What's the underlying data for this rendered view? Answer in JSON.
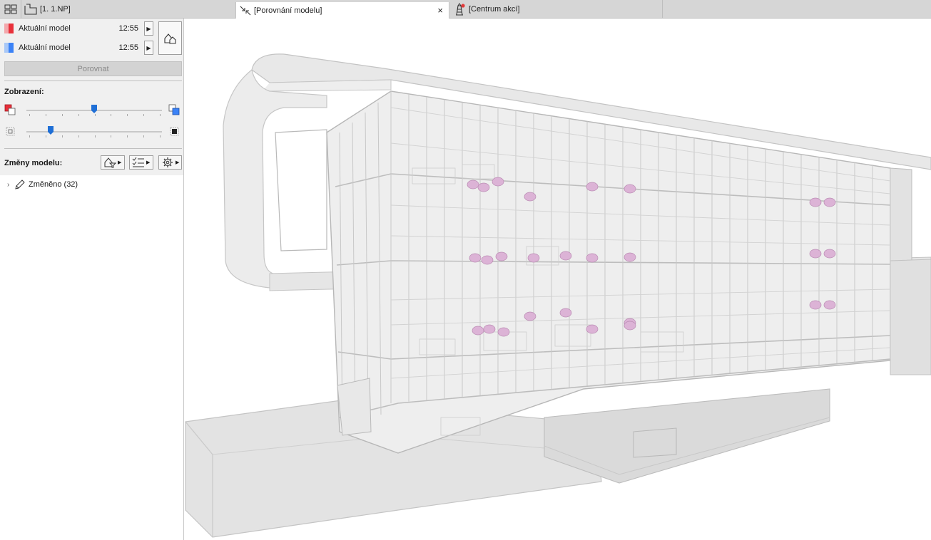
{
  "tabs": {
    "floor_label": "[1. 1.NP]",
    "compare_label": "[Porovnání modelu]",
    "action_label": "[Centrum akcí]",
    "close_glyph": "×"
  },
  "panel": {
    "models": [
      {
        "name": "Aktuální model",
        "time": "12:55",
        "color": "#e8303a"
      },
      {
        "name": "Aktuální model",
        "time": "12:55",
        "color": "#3b82f6"
      }
    ],
    "compare_button": "Porovnat",
    "display_label": "Zobrazení:",
    "sliders": [
      {
        "name": "model-color-mix",
        "value": 0.5
      },
      {
        "name": "transparency",
        "value": 0.18
      }
    ],
    "changes_label": "Změny modelu:",
    "tree": [
      {
        "label": "Změněno (32)",
        "expanded": false
      }
    ]
  },
  "colors": {
    "accent": "#1f6fd6",
    "old_model": "#e8303a",
    "new_model": "#3b82f6",
    "changed_element": "#d9a9cf"
  },
  "icons": [
    "layout-grid-icon",
    "floor-plan-icon",
    "compare-icon",
    "action-center-icon",
    "swap-models-icon",
    "filter-icon",
    "checklist-icon",
    "gear-icon",
    "pencil-icon"
  ]
}
